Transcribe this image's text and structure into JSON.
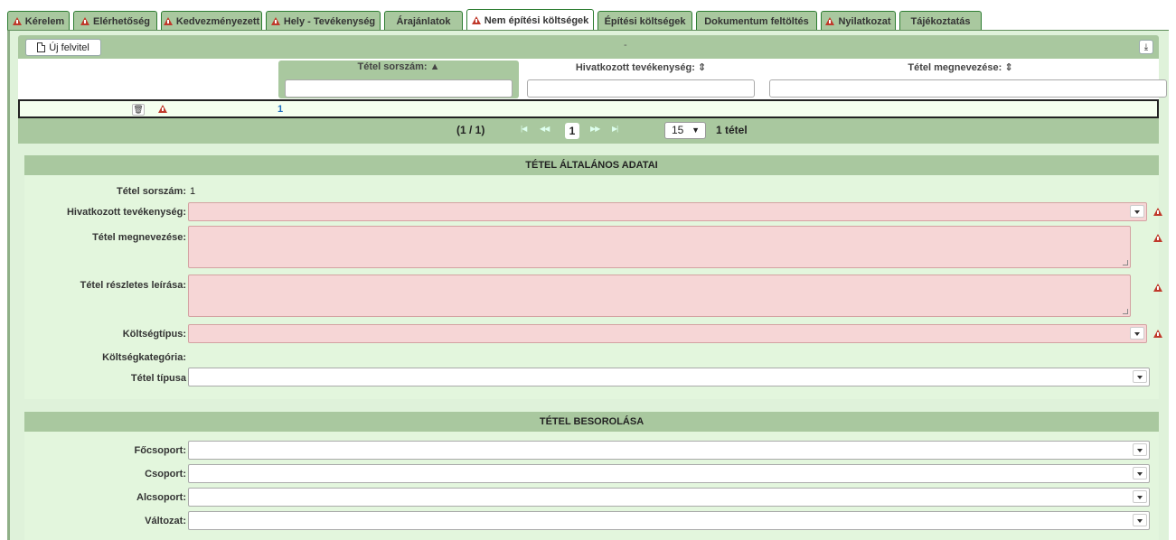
{
  "tabs": [
    {
      "label": "Kérelem",
      "warn": true
    },
    {
      "label": "Elérhetőség",
      "warn": true
    },
    {
      "label": "Kedvezményezett",
      "warn": true
    },
    {
      "label": "Hely - Tevékenység",
      "warn": true
    },
    {
      "label": "Árajánlatok",
      "warn": false
    },
    {
      "label": "Nem építési költségek",
      "warn": true,
      "active": true
    },
    {
      "label": "Építési költségek",
      "warn": false
    },
    {
      "label": "Dokumentum feltöltés",
      "warn": false
    },
    {
      "label": "Nyilatkozat",
      "warn": true
    },
    {
      "label": "Tájékoztatás",
      "warn": false
    }
  ],
  "toolbar": {
    "new_label": "Új felvitel",
    "center": "-",
    "export_icon": "download-icon"
  },
  "table": {
    "columns": [
      {
        "label": "Tétel sorszám: ▲",
        "sorted": true
      },
      {
        "label": "Hivatkozott tevékenység: ⇕",
        "sorted": false
      },
      {
        "label": "Tétel megnevezése: ⇕",
        "sorted": false
      }
    ],
    "rows": [
      {
        "id": "1"
      }
    ]
  },
  "paginator": {
    "info": "(1 / 1)",
    "first": "|◀",
    "prev": "◀◀",
    "page": "1",
    "next": "▶▶",
    "last": "▶|",
    "per_page": "15",
    "total": "1 tétel"
  },
  "general": {
    "title": "TÉTEL ÁLTALÁNOS ADATAI",
    "fields": {
      "sorszam_label": "Tétel sorszám:",
      "sorszam_value": "1",
      "tevekenyseg_label": "Hivatkozott tevékenység:",
      "megnevezes_label": "Tétel megnevezése:",
      "leiras_label": "Tétel részletes leírása:",
      "koltsegtipus_label": "Költségtípus:",
      "koltsegkategoria_label": "Költségkategória:",
      "tipus_label": "Tétel típusa"
    }
  },
  "classification": {
    "title": "TÉTEL BESOROLÁSA",
    "fields": {
      "focsoport_label": "Főcsoport:",
      "csoport_label": "Csoport:",
      "alcsoport_label": "Alcsoport:",
      "valtozat_label": "Változat:"
    }
  },
  "colors": {
    "accent": "#a9c89f",
    "panel": "#dff2da",
    "required": "#f6d6d6",
    "warn": "#c0392b",
    "link": "#1f6fbf"
  }
}
